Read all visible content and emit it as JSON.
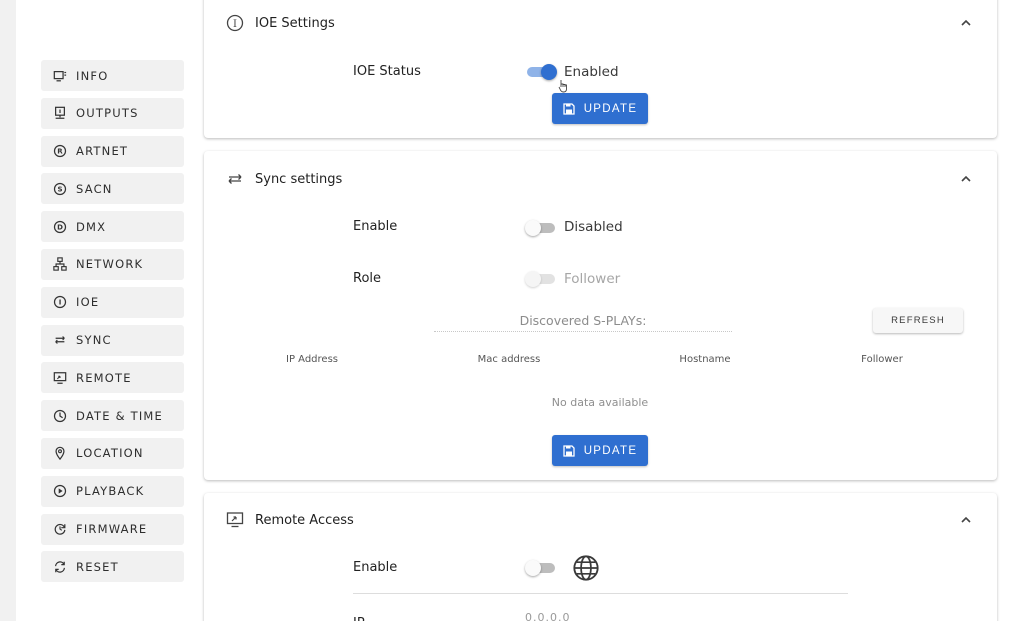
{
  "sidebar": {
    "items": [
      {
        "label": "INFO",
        "icon": "info-panel-icon"
      },
      {
        "label": "OUTPUTS",
        "icon": "outputs-icon"
      },
      {
        "label": "ARTNET",
        "icon": "artnet-r-circle-icon"
      },
      {
        "label": "SACN",
        "icon": "sacn-s-circle-icon"
      },
      {
        "label": "DMX",
        "icon": "dmx-d-circle-icon"
      },
      {
        "label": "NETWORK",
        "icon": "network-tree-icon"
      },
      {
        "label": "IOE",
        "icon": "ioe-i-circle-icon"
      },
      {
        "label": "SYNC",
        "icon": "sync-arrows-icon"
      },
      {
        "label": "REMOTE",
        "icon": "remote-monitor-icon"
      },
      {
        "label": "DATE & TIME",
        "icon": "clock-icon"
      },
      {
        "label": "LOCATION",
        "icon": "location-pin-icon"
      },
      {
        "label": "PLAYBACK",
        "icon": "play-circle-icon"
      },
      {
        "label": "FIRMWARE",
        "icon": "firmware-update-icon"
      },
      {
        "label": "RESET",
        "icon": "reset-icon"
      }
    ]
  },
  "ioe": {
    "title": "IOE Settings",
    "status_label": "IOE Status",
    "status_state": "Enabled",
    "status_on": true,
    "update_label": "UPDATE"
  },
  "sync": {
    "title": "Sync settings",
    "enable_label": "Enable",
    "enable_state": "Disabled",
    "role_label": "Role",
    "role_state": "Follower",
    "discovered_label": "Discovered S-PLAYs:",
    "refresh_label": "REFRESH",
    "columns": [
      "IP Address",
      "Mac address",
      "Hostname",
      "Follower"
    ],
    "no_data": "No data available",
    "update_label": "UPDATE"
  },
  "remote": {
    "title": "Remote Access",
    "enable_label": "Enable",
    "ip_label": "IP",
    "ip_value": "0.0.0.0"
  },
  "colors": {
    "accent": "#2f6fd0",
    "sidebar_bg": "#f1f1f1"
  }
}
